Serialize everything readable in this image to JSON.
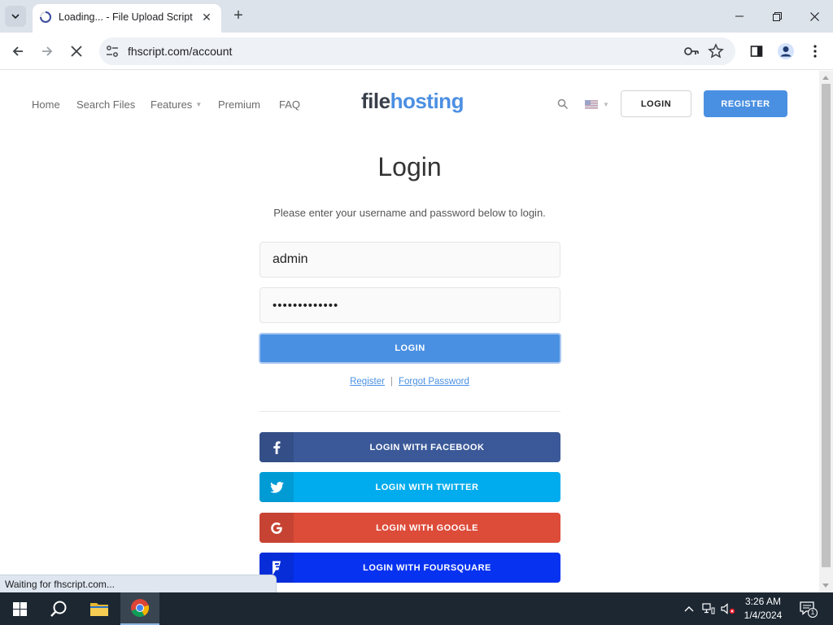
{
  "browser": {
    "tab_title": "Loading... - File Upload Script",
    "url": "fhscript.com/account",
    "status_text": "Waiting for fhscript.com..."
  },
  "site": {
    "nav": {
      "home": "Home",
      "search_files": "Search Files",
      "features": "Features",
      "premium": "Premium",
      "faq": "FAQ"
    },
    "logo_part1": "file",
    "logo_part2": "hosting",
    "header_login": "LOGIN",
    "header_register": "REGISTER"
  },
  "login": {
    "title": "Login",
    "subtitle": "Please enter your username and password below to login.",
    "username_value": "admin",
    "password_value": "•••••••••••••",
    "submit_label": "LOGIN",
    "register_link": "Register",
    "separator": "|",
    "forgot_link": "Forgot Password"
  },
  "social": {
    "facebook": "LOGIN WITH FACEBOOK",
    "twitter": "LOGIN WITH TWITTER",
    "google": "LOGIN WITH GOOGLE",
    "foursquare": "LOGIN WITH FOURSQUARE"
  },
  "taskbar": {
    "time": "3:26 AM",
    "date": "1/4/2024",
    "notification_count": "1"
  },
  "colors": {
    "accent": "#4a90e2",
    "facebook": "#3b5998",
    "twitter": "#00aced",
    "google": "#dd4b39",
    "foursquare": "#0732f0"
  }
}
